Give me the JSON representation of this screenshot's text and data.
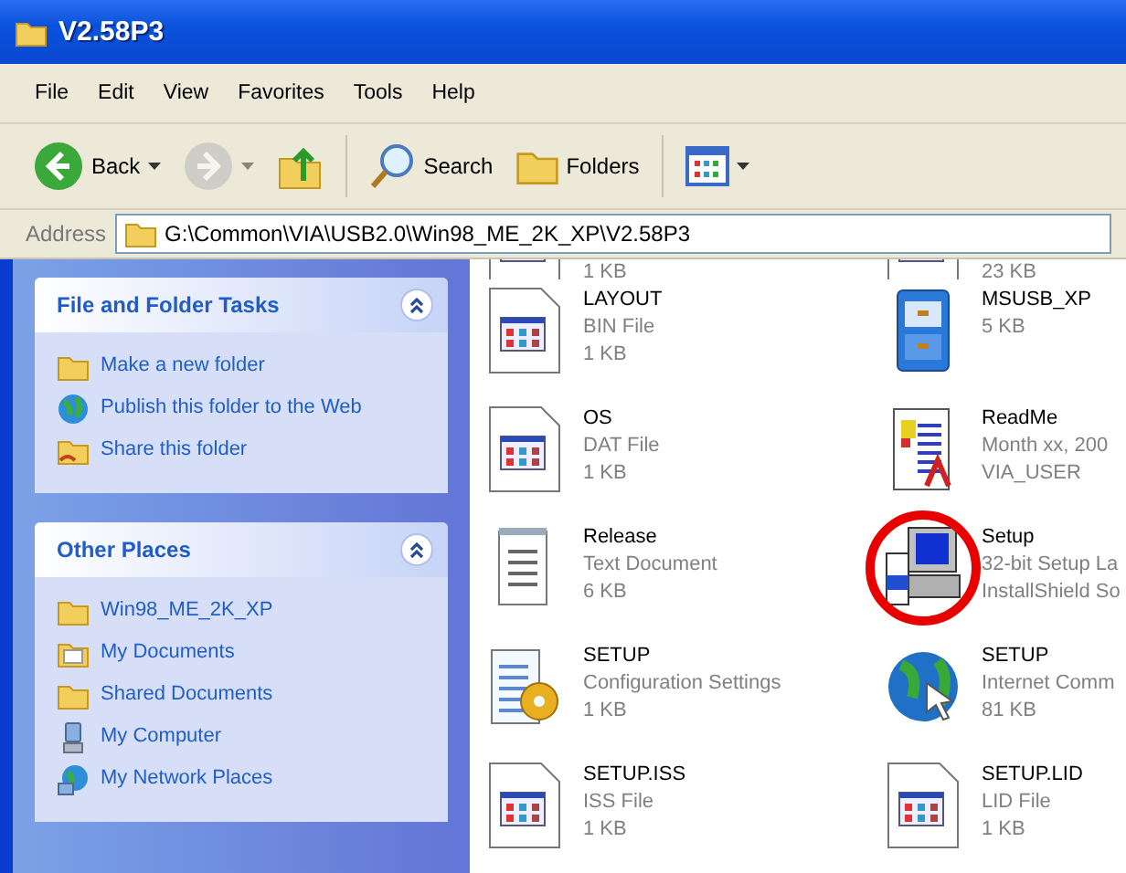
{
  "window": {
    "title": "V2.58P3"
  },
  "menu": [
    "File",
    "Edit",
    "View",
    "Favorites",
    "Tools",
    "Help"
  ],
  "toolbar": [
    {
      "kind": "back",
      "label": "Back",
      "disabled": false
    },
    {
      "kind": "forward",
      "disabled": true
    },
    {
      "kind": "up",
      "disabled": false
    },
    {
      "kind": "search",
      "label": "Search",
      "disabled": false
    },
    {
      "kind": "folders",
      "label": "Folders",
      "disabled": false
    },
    {
      "kind": "views",
      "disabled": false
    }
  ],
  "address": {
    "label": "Address",
    "value": "G:\\Common\\VIA\\USB2.0\\Win98_ME_2K_XP\\V2.58P3"
  },
  "panels": [
    {
      "title": "File and Folder Tasks",
      "expanded": true,
      "items": [
        {
          "kind": "new-folder",
          "label": "Make a new folder"
        },
        {
          "kind": "publish",
          "label": "Publish this folder to the Web"
        },
        {
          "kind": "share",
          "label": "Share this folder"
        }
      ]
    },
    {
      "title": "Other Places",
      "expanded": true,
      "items": [
        {
          "kind": "folder",
          "label": "Win98_ME_2K_XP"
        },
        {
          "kind": "documents",
          "label": "My Documents"
        },
        {
          "kind": "folder",
          "label": "Shared Documents"
        },
        {
          "kind": "computer",
          "label": "My Computer"
        },
        {
          "kind": "network",
          "label": "My Network Places"
        }
      ]
    }
  ],
  "partly_hidden_row": [
    "1 KB",
    "23 KB"
  ],
  "files": [
    {
      "kind": "generic",
      "highlighted": false,
      "lines": [
        "LAYOUT",
        "BIN File",
        "1 KB"
      ]
    },
    {
      "kind": "cabinet",
      "highlighted": false,
      "lines": [
        "MSUSB_XP",
        "5 KB"
      ]
    },
    {
      "kind": "generic",
      "highlighted": false,
      "lines": [
        "OS",
        "DAT File",
        "1 KB"
      ]
    },
    {
      "kind": "readme",
      "highlighted": false,
      "lines": [
        "ReadMe",
        "Month xx, 200",
        "VIA_USER"
      ]
    },
    {
      "kind": "notepad",
      "highlighted": false,
      "lines": [
        "Release",
        "Text Document",
        "6 KB"
      ]
    },
    {
      "kind": "installer",
      "highlighted": true,
      "lines": [
        "Setup",
        "32-bit Setup La",
        "InstallShield So"
      ]
    },
    {
      "kind": "config",
      "highlighted": false,
      "lines": [
        "SETUP",
        "Configuration Settings",
        "1 KB"
      ]
    },
    {
      "kind": "globe",
      "highlighted": false,
      "lines": [
        "SETUP",
        "Internet Comm",
        "81 KB"
      ]
    },
    {
      "kind": "generic",
      "highlighted": false,
      "lines": [
        "SETUP.ISS",
        "ISS File",
        "1 KB"
      ]
    },
    {
      "kind": "generic",
      "highlighted": false,
      "lines": [
        "SETUP.LID",
        "LID File",
        "1 KB"
      ]
    }
  ]
}
